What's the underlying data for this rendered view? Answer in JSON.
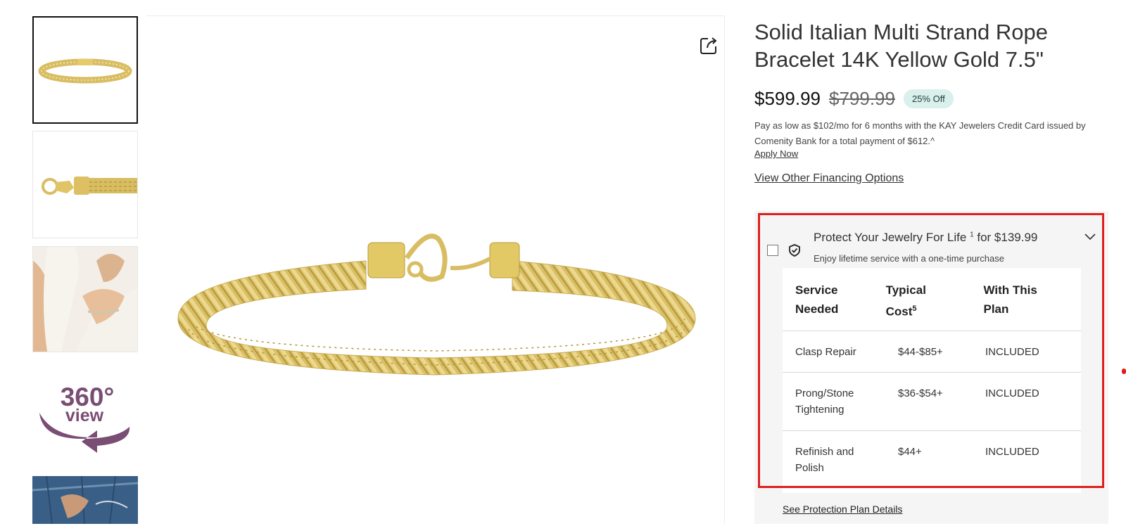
{
  "product": {
    "title": "Solid Italian Multi Strand Rope Bracelet 14K Yellow Gold 7.5\"",
    "price": "$599.99",
    "original_price": "$799.99",
    "discount_badge": "25% Off"
  },
  "financing": {
    "text": "Pay as low as $102/mo for 6 months with the KAY Jewelers Credit Card issued by Comenity Bank for a total payment of $612.^",
    "apply_link": "Apply Now",
    "other_options_link": "View Other Financing Options"
  },
  "thumbnails": [
    {
      "name": "bracelet-front",
      "selected": true
    },
    {
      "name": "bracelet-clasp-closeup",
      "selected": false
    },
    {
      "name": "bracelet-on-wrist",
      "selected": false
    },
    {
      "name": "360-view",
      "selected": false,
      "label_top": "360°",
      "label_bottom": "view"
    },
    {
      "name": "denim-lifestyle",
      "selected": false
    }
  ],
  "protection_plan": {
    "heading": "Protect Your Jewelry For Life",
    "heading_sup": "1",
    "heading_price": "for $139.99",
    "subtext": "Enjoy lifetime service with a one-time purchase",
    "table": {
      "headers": [
        "Service Needed",
        "Typical Cost",
        "With This Plan"
      ],
      "cost_sup": "5",
      "rows": [
        [
          "Clasp Repair",
          "$44-$85+",
          "INCLUDED"
        ],
        [
          "Prong/Stone Tightening",
          "$36-$54+",
          "INCLUDED"
        ],
        [
          "Refinish and Polish",
          "$44+",
          "INCLUDED"
        ]
      ]
    },
    "details_link": "See Protection Plan Details"
  },
  "colors": {
    "gold": "#d8bd63",
    "highlight_outline": "#e01e1e",
    "badge_bg": "#d9f0ec",
    "view360_purple": "#7a4d74"
  },
  "icons": {
    "share": "share-icon",
    "shield": "shield-check-icon",
    "chevron": "chevron-down-icon"
  }
}
